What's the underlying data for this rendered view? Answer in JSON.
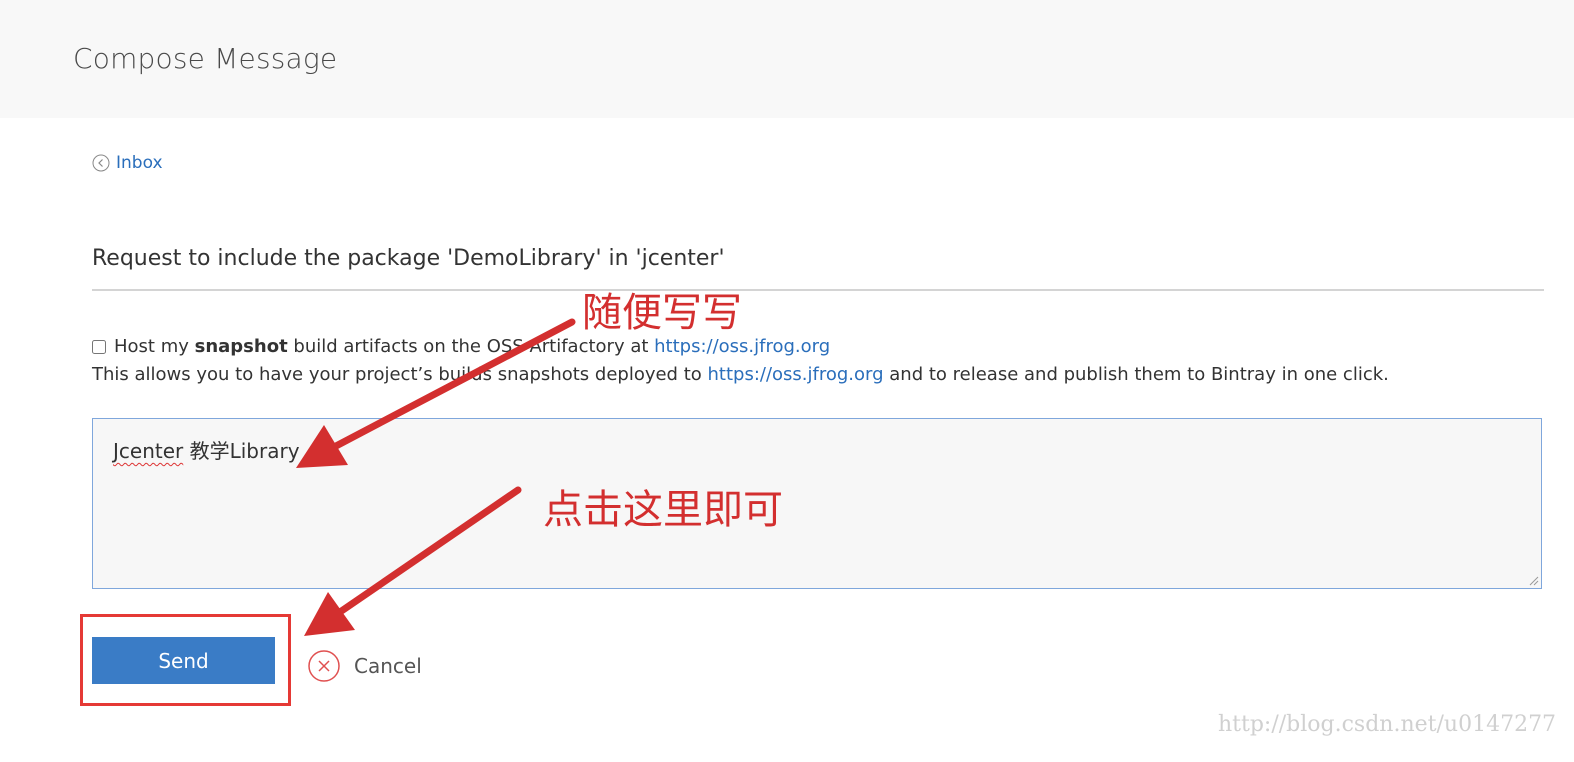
{
  "header": {
    "title": "Compose Message"
  },
  "nav": {
    "inbox_label": "Inbox"
  },
  "form": {
    "subject": "Request to include the package 'DemoLibrary' in 'jcenter'",
    "snapshot": {
      "prefix": "Host my ",
      "bold": "snapshot",
      "middle": " build artifacts on the OSS Artifactory at ",
      "link": "https://oss.jfrog.org"
    },
    "allow": {
      "prefix": "This allows you to have your project’s builds snapshots deployed to ",
      "link": "https://oss.jfrog.org",
      "suffix": " and to release and publish them to Bintray in one click."
    },
    "message_word": "Jcenter",
    "message_rest": " 教学Library",
    "send_label": "Send",
    "cancel_label": "Cancel"
  },
  "annotations": {
    "note1": "随便写写",
    "note2": "点击这里即可",
    "arrow_color": "#d32f2f"
  },
  "watermark": "http://blog.csdn.net/u0147277"
}
